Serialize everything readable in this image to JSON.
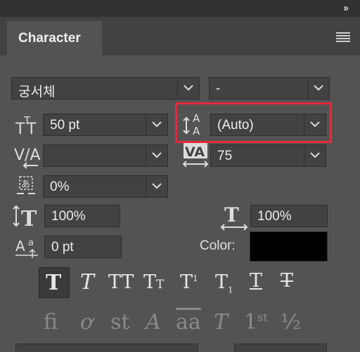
{
  "panel": {
    "collapse_icon": "double-chevron-right-icon",
    "tab_title": "Character",
    "menu_icon": "panel-menu-icon"
  },
  "font": {
    "family": "궁서체",
    "style": "-"
  },
  "size": {
    "value": "50 pt",
    "icon": "font-size-icon"
  },
  "leading": {
    "value": "(Auto)",
    "icon": "leading-icon"
  },
  "kerning": {
    "value": "",
    "icon": "kerning-icon"
  },
  "tracking": {
    "value": "75",
    "icon": "tracking-icon"
  },
  "tsume": {
    "value": "0%",
    "icon": "tsume-icon"
  },
  "vertical_scale": {
    "value": "100%",
    "icon": "vertical-scale-icon"
  },
  "horizontal_scale": {
    "value": "100%",
    "icon": "horizontal-scale-icon"
  },
  "baseline_shift": {
    "value": "0 pt",
    "icon": "baseline-shift-icon"
  },
  "color": {
    "label": "Color:",
    "value": "#000000"
  },
  "highlight_color": "#e8283c",
  "type_styles": [
    {
      "name": "faux-bold",
      "glyph": "T"
    },
    {
      "name": "faux-italic",
      "glyph": "T"
    },
    {
      "name": "all-caps",
      "glyph": "TT"
    },
    {
      "name": "small-caps",
      "glyph": "Tт"
    },
    {
      "name": "superscript",
      "glyph": "T¹"
    },
    {
      "name": "subscript",
      "glyph": "T₁"
    },
    {
      "name": "underline",
      "glyph": "T"
    },
    {
      "name": "strikethrough",
      "glyph": "T"
    }
  ],
  "opentype": [
    {
      "name": "ligatures",
      "glyph": "fi"
    },
    {
      "name": "old-style",
      "glyph": "ơ"
    },
    {
      "name": "discretionary-ligatures",
      "glyph": "st"
    },
    {
      "name": "swash",
      "glyph": "A"
    },
    {
      "name": "titling",
      "glyph": "aa"
    },
    {
      "name": "stylistic-alternates",
      "glyph": "T"
    },
    {
      "name": "ordinals",
      "glyph": "1st"
    },
    {
      "name": "fractions",
      "glyph": "½"
    }
  ]
}
